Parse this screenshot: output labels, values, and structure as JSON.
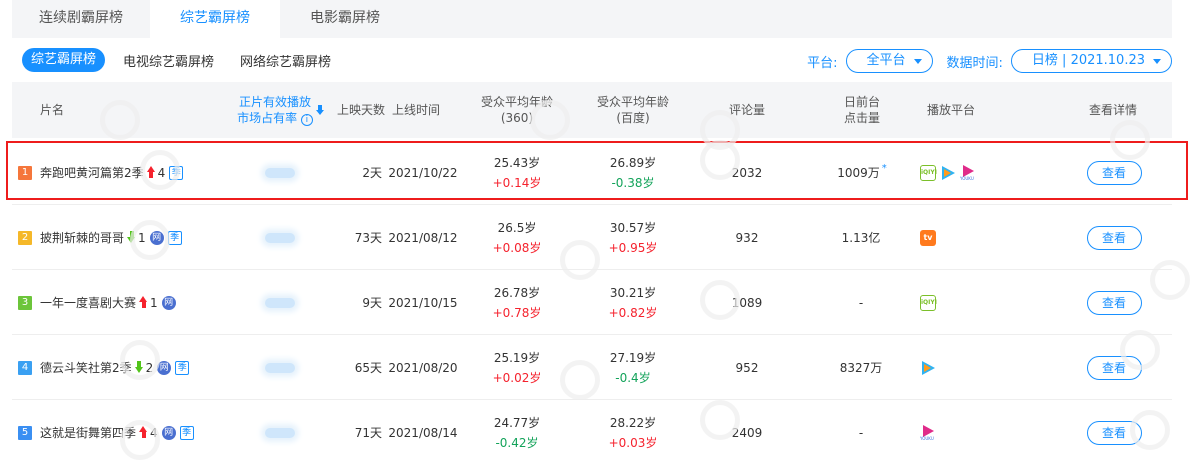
{
  "top_tabs": [
    "连续剧霸屏榜",
    "综艺霸屏榜",
    "电影霸屏榜"
  ],
  "sub_tabs": [
    "综艺霸屏榜",
    "电视综艺霸屏榜",
    "网络综艺霸屏榜"
  ],
  "filters": {
    "platform_label": "平台:",
    "platform_value": "全平台",
    "date_label": "数据时间:",
    "date_value": "日榜 | 2021.10.23"
  },
  "headers": {
    "name": "片名",
    "share_line1": "正片有效播放",
    "share_line2": "市场占有率",
    "share_info": "i",
    "days": "上映天数",
    "date": "上线时间",
    "age360_line1": "受众平均年龄",
    "age360_line2": "(360)",
    "agebaidu_line1": "受众平均年龄",
    "agebaidu_line2": "(百度)",
    "comments": "评论量",
    "clicks_line1": "日前台",
    "clicks_line2": "点击量",
    "platforms": "播放平台",
    "details": "查看详情"
  },
  "colors": {
    "accent": "#1890ff",
    "rank1": "#f5763b",
    "rank2": "#f5b829",
    "rank3": "#6cc53a",
    "rank4": "#3aa0f2",
    "rank5": "#3a8ff2",
    "highlight": "#ee1c1c",
    "positive": "#f5222d",
    "negative": "#13a35a"
  },
  "rows": [
    {
      "rank": "1",
      "title": "奔跑吧黄河篇第2季",
      "change_dir": "up",
      "change": "4",
      "badges": [
        "季"
      ],
      "days": "2天",
      "date": "2021/10/22",
      "age360": "25.43岁",
      "age360_delta": "+0.14岁",
      "age360_dir": "pos",
      "agebaidu": "26.89岁",
      "agebaidu_delta": "-0.38岁",
      "agebaidu_dir": "neg",
      "comments": "2032",
      "clicks": "1009万",
      "clicks_star": "*",
      "platforms": [
        "iqiyi-icon",
        "tencent-video-icon",
        "youku-icon"
      ],
      "view": "查看"
    },
    {
      "rank": "2",
      "title": "披荆斩棘的哥哥",
      "change_dir": "down",
      "change": "1",
      "badges": [
        "网",
        "季"
      ],
      "days": "73天",
      "date": "2021/08/12",
      "age360": "26.5岁",
      "age360_delta": "+0.08岁",
      "age360_dir": "pos",
      "agebaidu": "30.57岁",
      "agebaidu_delta": "+0.95岁",
      "agebaidu_dir": "pos",
      "comments": "932",
      "clicks": "1.13亿",
      "clicks_star": "",
      "platforms": [
        "mgtv-icon"
      ],
      "view": "查看"
    },
    {
      "rank": "3",
      "title": "一年一度喜剧大赛",
      "change_dir": "up",
      "change": "1",
      "badges": [
        "网"
      ],
      "days": "9天",
      "date": "2021/10/15",
      "age360": "26.78岁",
      "age360_delta": "+0.78岁",
      "age360_dir": "pos",
      "agebaidu": "30.21岁",
      "agebaidu_delta": "+0.82岁",
      "agebaidu_dir": "pos",
      "comments": "1089",
      "clicks": "-",
      "clicks_star": "",
      "platforms": [
        "iqiyi-icon"
      ],
      "view": "查看"
    },
    {
      "rank": "4",
      "title": "德云斗笑社第2季",
      "change_dir": "down",
      "change": "2",
      "badges": [
        "网",
        "季"
      ],
      "days": "65天",
      "date": "2021/08/20",
      "age360": "25.19岁",
      "age360_delta": "+0.02岁",
      "age360_dir": "pos",
      "agebaidu": "27.19岁",
      "agebaidu_delta": "-0.4岁",
      "agebaidu_dir": "neg",
      "comments": "952",
      "clicks": "8327万",
      "clicks_star": "",
      "platforms": [
        "tencent-video-icon"
      ],
      "view": "查看"
    },
    {
      "rank": "5",
      "title": "这就是街舞第四季",
      "change_dir": "up",
      "change": "4",
      "badges": [
        "网",
        "季"
      ],
      "days": "71天",
      "date": "2021/08/14",
      "age360": "24.77岁",
      "age360_delta": "-0.42岁",
      "age360_dir": "neg",
      "agebaidu": "28.22岁",
      "agebaidu_delta": "+0.03岁",
      "agebaidu_dir": "pos",
      "comments": "2409",
      "clicks": "-",
      "clicks_star": "",
      "platforms": [
        "youku-icon"
      ],
      "view": "查看"
    }
  ]
}
